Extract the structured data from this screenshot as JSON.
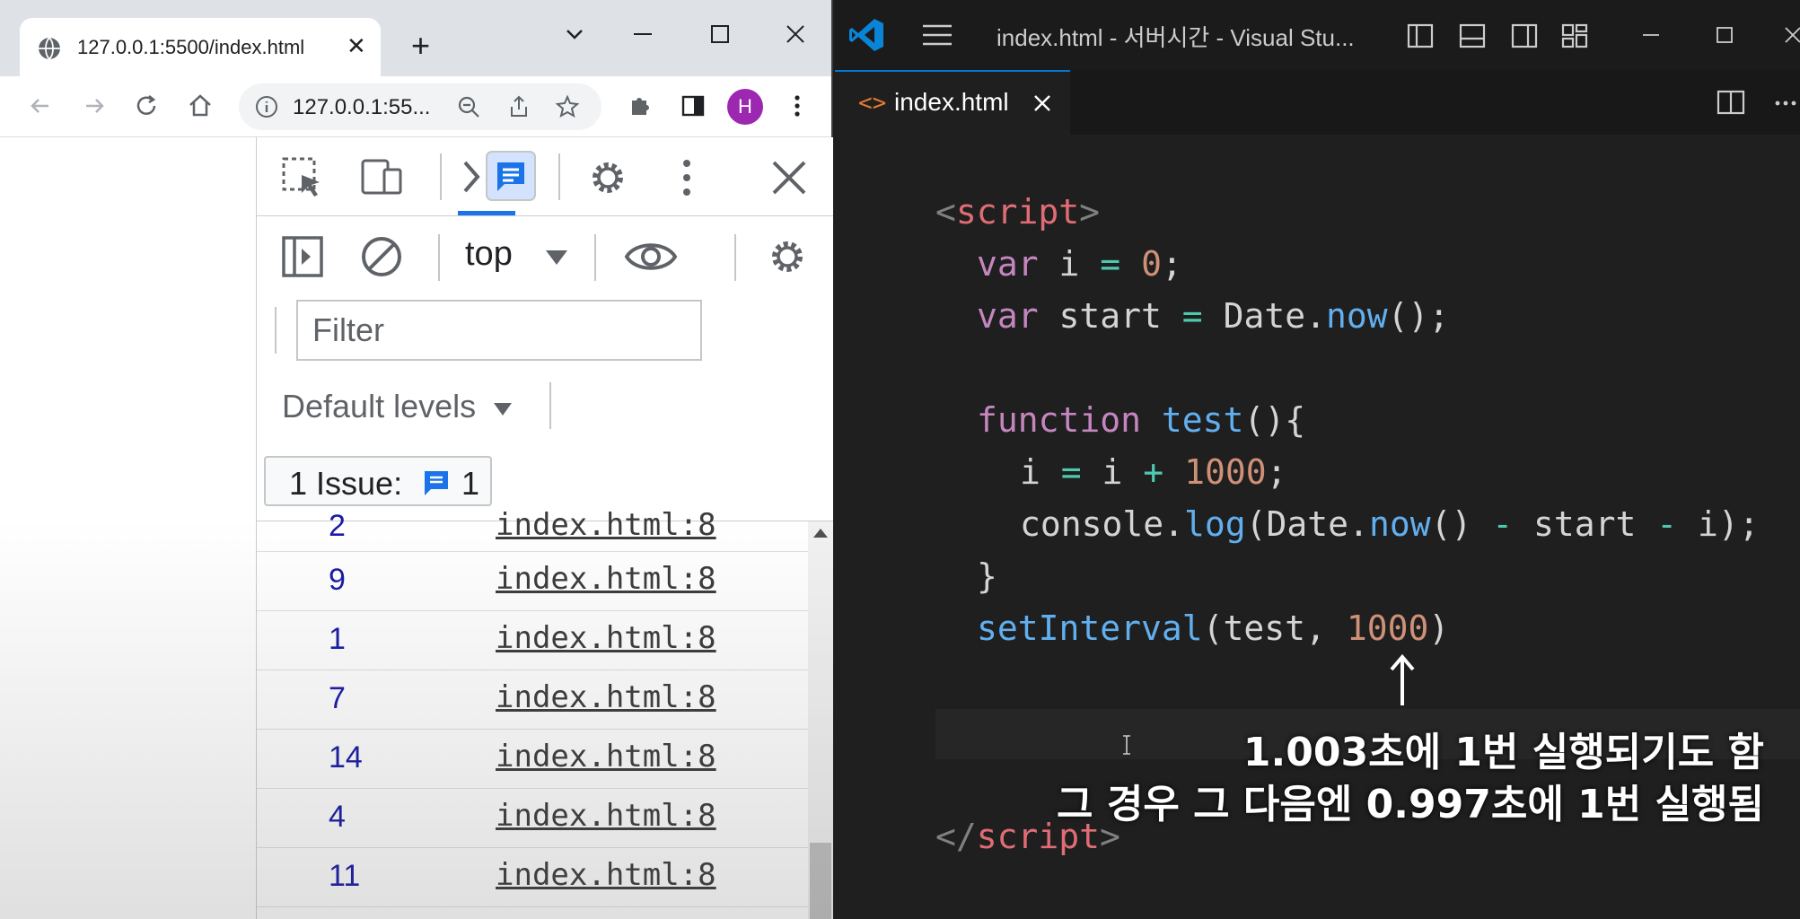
{
  "browser": {
    "tab_title": "127.0.0.1:5500/index.html",
    "tab_close": "✕",
    "new_tab": "+",
    "url": "127.0.0.1:55...",
    "profile_initial": "H"
  },
  "devtools": {
    "context": "top",
    "filter_placeholder": "Filter",
    "levels": "Default levels",
    "issues_label": "1 Issue:",
    "issues_count": "1",
    "logs": [
      {
        "value": "2",
        "source": "index.html:8"
      },
      {
        "value": "9",
        "source": "index.html:8"
      },
      {
        "value": "1",
        "source": "index.html:8"
      },
      {
        "value": "7",
        "source": "index.html:8"
      },
      {
        "value": "14",
        "source": "index.html:8"
      },
      {
        "value": "4",
        "source": "index.html:8"
      },
      {
        "value": "11",
        "source": "index.html:8"
      }
    ]
  },
  "vscode": {
    "window_title": "index.html - 서버시간 - Visual Stu...",
    "tab_label": "index.html",
    "tab_icon": "<>",
    "code": {
      "l1_open": "<",
      "l1_name": "script",
      "l1_close": ">",
      "l2": [
        "var",
        " i ",
        "=",
        " ",
        "0",
        ";"
      ],
      "l3": [
        "var",
        " start ",
        "=",
        " Date.",
        "now",
        "();"
      ],
      "l5": [
        "function",
        " ",
        "test",
        "(){"
      ],
      "l6": [
        "i ",
        "=",
        " i ",
        "+",
        " ",
        "1000",
        ";"
      ],
      "l7": [
        "console.",
        "log",
        "(Date.",
        "now",
        "() ",
        "-",
        " start ",
        "-",
        " i);"
      ],
      "l8": "}",
      "l9": [
        "setInterval",
        "(test, ",
        "1000",
        ")"
      ],
      "l_end_open": "</",
      "l_end_name": "script",
      "l_end_close": ">"
    },
    "caption_line1": "1.003초에 1번 실행되기도 함",
    "caption_line2": "그 경우 그 다음엔 0.997초에 1번 실행됨"
  },
  "colors": {
    "vscode_bg": "#1f1f1f",
    "keyword": "#c586c0",
    "function": "#61afef",
    "number": "#ce9178",
    "devtools_accent": "#1a73e8"
  }
}
